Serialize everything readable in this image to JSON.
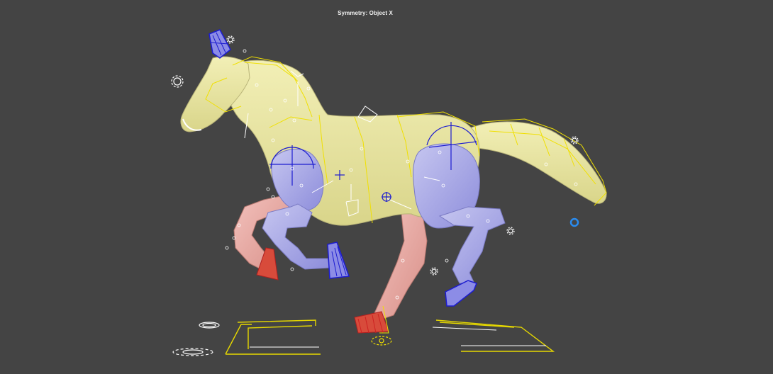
{
  "viewport": {
    "label": "Symmetry: Object X"
  },
  "colors": {
    "background": "#444444",
    "body": "#e6e3a0",
    "left_limb": "#a9a9e3",
    "right_limb": "#e7a6a0",
    "left_controls": "#1c1cd0",
    "right_controls": "#d01c1c",
    "rig_wire": "#f0e000",
    "helper": "#ffffff",
    "selection_ring": "#2a8cf0"
  },
  "icons": [
    "gear-icon",
    "target-icon",
    "ring-icon"
  ]
}
